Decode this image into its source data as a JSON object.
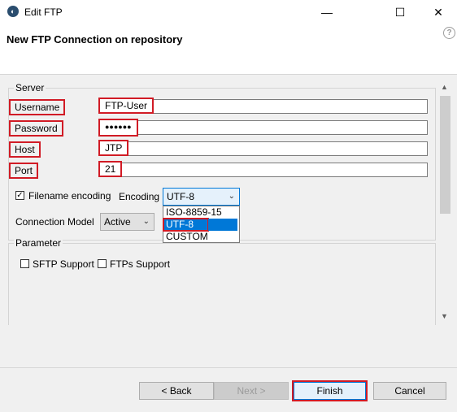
{
  "window": {
    "title": "Edit FTP",
    "minimize_glyph": "—",
    "maximize_glyph": "☐",
    "close_glyph": "✕"
  },
  "header": {
    "title": "New FTP Connection on repository",
    "help_glyph": "?"
  },
  "server": {
    "label": "Server",
    "username_label": "Username",
    "username_value": "FTP-User",
    "password_label": "Password",
    "password_value": "●●●●●●",
    "host_label": "Host",
    "host_value": "JTP",
    "port_label": "Port",
    "port_value": "21",
    "filename_encoding_label": "Filename encoding",
    "filename_encoding_checked": "✓",
    "encoding_label": "Encoding",
    "encoding_value": "UTF-8",
    "encoding_options": [
      "ISO-8859-15",
      "UTF-8",
      "CUSTOM"
    ],
    "connection_model_label": "Connection Model",
    "connection_model_value": "Active"
  },
  "parameter": {
    "label": "Parameter",
    "sftp_label": "SFTP Support",
    "ftps_label": "FTPs Support"
  },
  "buttons": {
    "back": "< Back",
    "next": "Next >",
    "finish": "Finish",
    "cancel": "Cancel"
  },
  "colors": {
    "highlight_red": "#d11b25",
    "selection_blue": "#0078d7"
  }
}
